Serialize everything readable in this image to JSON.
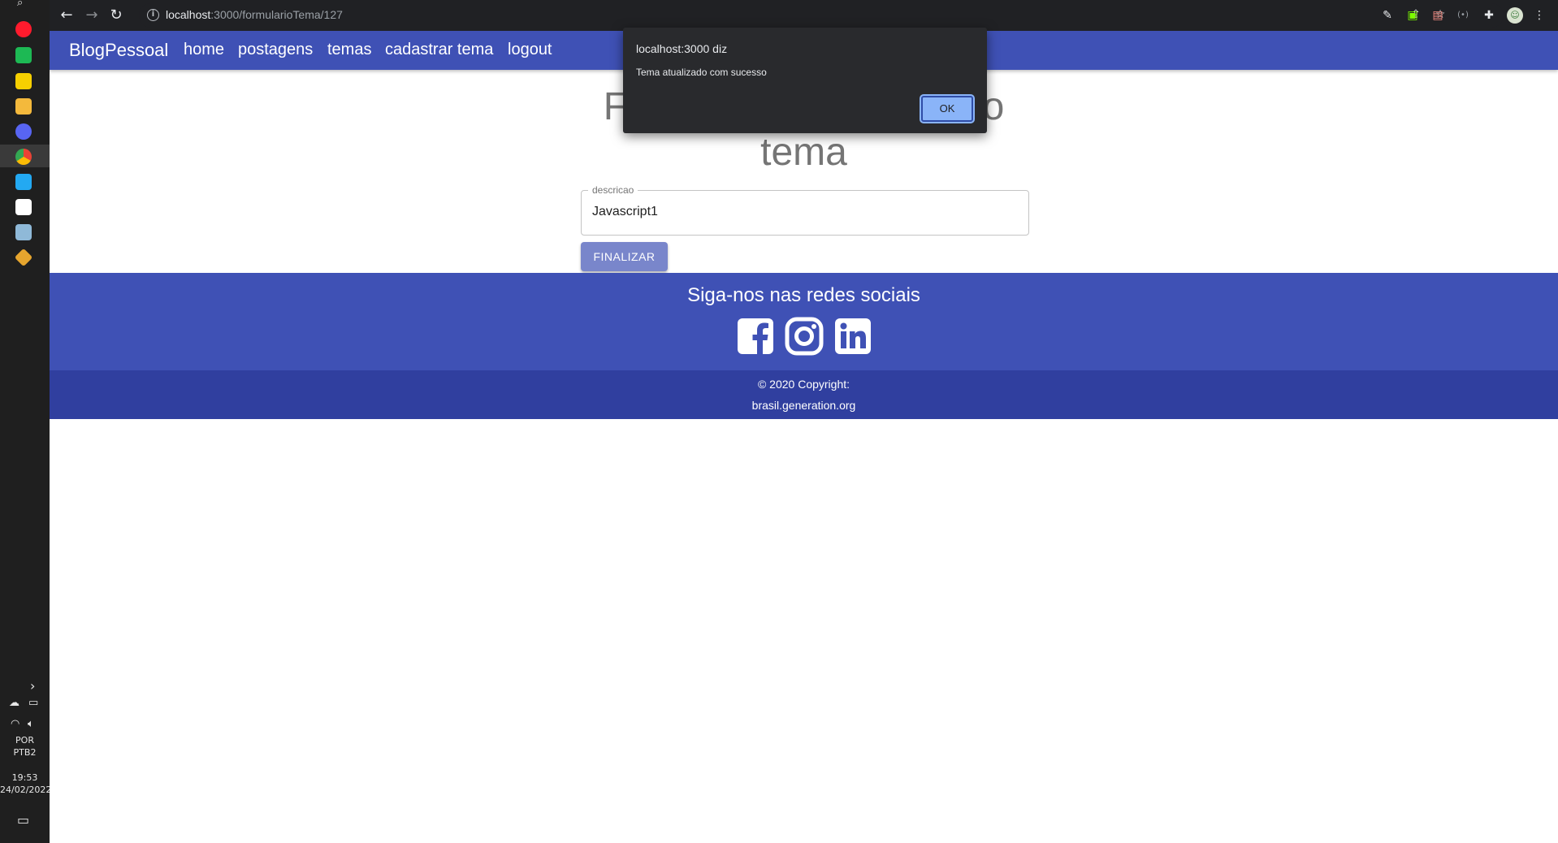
{
  "taskbar": {
    "language_top": "POR",
    "language_bottom": "PTB2",
    "time": "19:53",
    "date": "24/02/2022"
  },
  "browser": {
    "url_host": "localhost",
    "url_rest": ":3000/formularioTema/127"
  },
  "app": {
    "brand": "BlogPessoal",
    "nav": [
      {
        "label": "home"
      },
      {
        "label": "postagens"
      },
      {
        "label": "temas"
      },
      {
        "label": "cadastrar tema"
      },
      {
        "label": "logout"
      }
    ]
  },
  "form": {
    "title_line1": "Formulário de cadastro",
    "title_line2": "tema",
    "field_label": "descricao",
    "field_value": "Javascript1",
    "submit_label": "FINALIZAR"
  },
  "footer": {
    "heading": "Siga-nos nas redes sociais",
    "social_icons": [
      "facebook-icon",
      "instagram-icon",
      "linkedin-icon"
    ],
    "copyright": "© 2020 Copyright:",
    "site": "brasil.generation.org"
  },
  "dialog": {
    "title": "localhost:3000 diz",
    "message": "Tema atualizado com sucesso",
    "ok_label": "OK"
  },
  "colors": {
    "primary": "#3f51b5",
    "primary_dark": "#303f9f",
    "button": "#7986cb",
    "dialog_bg": "#292a2d",
    "dialog_ok": "#8ab4f8"
  }
}
